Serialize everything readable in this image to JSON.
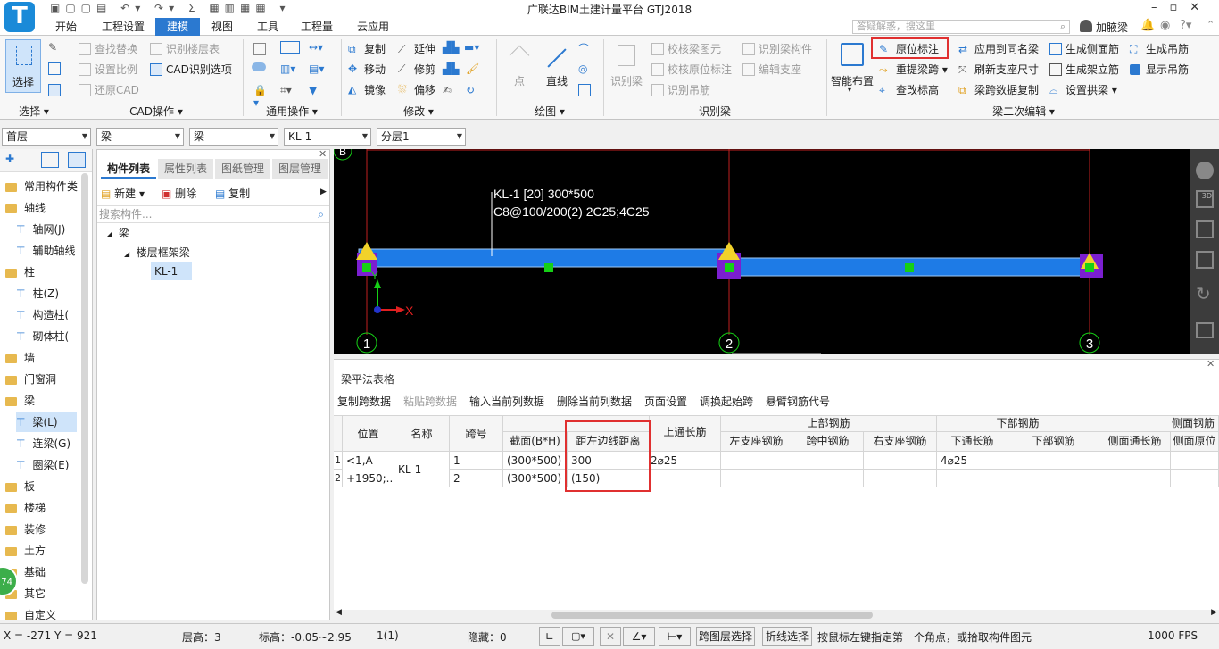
{
  "app": {
    "title": "广联达BIM土建计量平台 GTJ2018",
    "user": "加腋梁",
    "search_placeholder": "答疑解惑，搜这里"
  },
  "tabs": [
    "开始",
    "工程设置",
    "建模",
    "视图",
    "工具",
    "工程量",
    "云应用"
  ],
  "ribbon": {
    "select": {
      "label": "选择",
      "group": "选择"
    },
    "cad": {
      "items": [
        "查找替换",
        "识别楼层表",
        "设置比例",
        "CAD识别选项",
        "还原CAD"
      ],
      "group": "CAD操作"
    },
    "general": {
      "group": "通用操作"
    },
    "modify": {
      "items": [
        "复制",
        "延伸",
        "移动",
        "修剪",
        "镜像",
        "偏移"
      ],
      "group": "修改"
    },
    "draw": {
      "items": [
        "点",
        "直线"
      ],
      "group": "绘图"
    },
    "recognize": {
      "items": [
        "识别梁",
        "校核梁图元",
        "识别梁构件",
        "校核原位标注",
        "编辑支座",
        "识别吊筋"
      ],
      "group": "识别梁"
    },
    "beam2": {
      "smart": "智能布置",
      "items": [
        "原位标注",
        "应用到同名梁",
        "生成侧面筋",
        "生成吊筋",
        "重提梁跨",
        "刷新支座尺寸",
        "生成架立筋",
        "显示吊筋",
        "查改标高",
        "梁跨数据复制",
        "设置拱梁"
      ],
      "group": "梁二次编辑"
    }
  },
  "filters": [
    "首层",
    "梁",
    "梁",
    "KL-1",
    "分层1"
  ],
  "leftnav": [
    {
      "label": "常用构件类",
      "type": "folder"
    },
    {
      "label": "轴线",
      "type": "folder"
    },
    {
      "label": "轴网(J)",
      "type": "item"
    },
    {
      "label": "辅助轴线",
      "type": "item"
    },
    {
      "label": "柱",
      "type": "folder"
    },
    {
      "label": "柱(Z)",
      "type": "item"
    },
    {
      "label": "构造柱(",
      "type": "item"
    },
    {
      "label": "砌体柱(",
      "type": "item"
    },
    {
      "label": "墙",
      "type": "folder"
    },
    {
      "label": "门窗洞",
      "type": "folder"
    },
    {
      "label": "梁",
      "type": "folder"
    },
    {
      "label": "梁(L)",
      "type": "item",
      "selected": true
    },
    {
      "label": "连梁(G)",
      "type": "item"
    },
    {
      "label": "圈梁(E)",
      "type": "item"
    },
    {
      "label": "板",
      "type": "folder"
    },
    {
      "label": "楼梯",
      "type": "folder"
    },
    {
      "label": "装修",
      "type": "folder"
    },
    {
      "label": "土方",
      "type": "folder"
    },
    {
      "label": "基础",
      "type": "folder"
    },
    {
      "label": "其它",
      "type": "folder"
    },
    {
      "label": "自定义",
      "type": "folder"
    }
  ],
  "panel": {
    "tabs": [
      "构件列表",
      "属性列表",
      "图纸管理",
      "图层管理"
    ],
    "actions": [
      "新建",
      "删除",
      "复制"
    ],
    "search_placeholder": "搜索构件...",
    "tree": {
      "root": "梁",
      "group": "楼层框架梁",
      "leaf": "KL-1"
    }
  },
  "canvas": {
    "label1": "KL-1 [20] 300*500",
    "label2": "C8@100/200(2) 2C25;4C25",
    "axes": [
      "1",
      "2",
      "3"
    ],
    "axis_top": "B",
    "x_axis": "X",
    "y_axis": "Y"
  },
  "table": {
    "title": "梁平法表格",
    "toolbar": [
      "复制跨数据",
      "粘贴跨数据",
      "输入当前列数据",
      "删除当前列数据",
      "页面设置",
      "调换起始跨",
      "悬臂钢筋代号"
    ],
    "group_headers": [
      "上部钢筋",
      "下部钢筋",
      "侧面钢筋"
    ],
    "headers": [
      "位置",
      "名称",
      "跨号",
      "截面(B*H)",
      "距左边线距离",
      "上通长筋",
      "左支座钢筋",
      "跨中钢筋",
      "右支座钢筋",
      "下通长筋",
      "下部钢筋",
      "侧面通长筋",
      "侧面原位"
    ],
    "rows": [
      {
        "num": "1",
        "pos1": "<1,A",
        "pos2": "+1950;...",
        "name": "KL-1",
        "span": "1",
        "section": "(300*500)",
        "dist": "300",
        "top": "2⌀25",
        "bottom": "4⌀25"
      },
      {
        "num": "2",
        "span": "2",
        "section": "(300*500)",
        "dist": "(150)",
        "top": "",
        "bottom": ""
      }
    ]
  },
  "status": {
    "coords": "X = -271 Y = 921",
    "floor_h": "层高：3",
    "elev": "标高：-0.05~2.95",
    "count": "1(1)",
    "hidden": "隐藏：0",
    "btn1": "跨图层选择",
    "btn2": "折线选择",
    "hint": "按鼠标左键指定第一个角点，或拾取构件图元",
    "fps": "1000 FPS",
    "badge": "74"
  },
  "colors": {
    "accent": "#2b79d0",
    "beam": "#1e7be6",
    "highlight": "#e03030",
    "support": "#7b1fd0",
    "marker": "#f2d22a",
    "node": "#16d016"
  }
}
